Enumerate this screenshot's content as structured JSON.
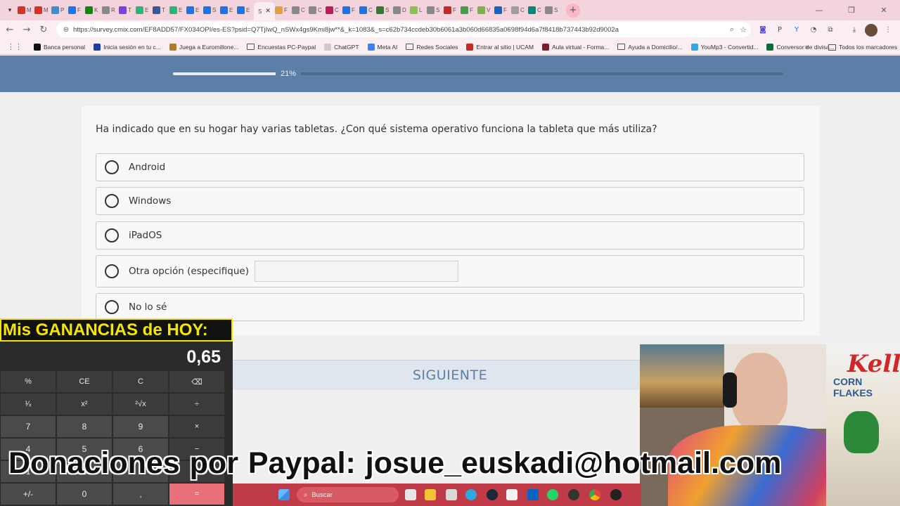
{
  "browser": {
    "tabs": [
      {
        "letter": "M",
        "color": "#d93025"
      },
      {
        "letter": "M",
        "color": "#d93025"
      },
      {
        "letter": "P",
        "color": "#3b8fd4"
      },
      {
        "letter": "F",
        "color": "#1877f2"
      },
      {
        "letter": "K",
        "color": "#0a8a0a"
      },
      {
        "letter": "R",
        "color": "#888888"
      },
      {
        "letter": "T",
        "color": "#7b3fe4"
      },
      {
        "letter": "E",
        "color": "#2bb673"
      },
      {
        "letter": "T",
        "color": "#3b5998"
      },
      {
        "letter": "E",
        "color": "#2bb673"
      },
      {
        "letter": "E",
        "color": "#1a73e8"
      },
      {
        "letter": "S",
        "color": "#1a73e8"
      },
      {
        "letter": "E",
        "color": "#1a73e8"
      },
      {
        "letter": "E",
        "color": "#1a73e8"
      }
    ],
    "active_tab_letter": "S",
    "tabs_after": [
      {
        "letter": "F",
        "color": "#e2a03a"
      },
      {
        "letter": "C",
        "color": "#888888"
      },
      {
        "letter": "C",
        "color": "#888888"
      },
      {
        "letter": "C",
        "color": "#c2185b"
      },
      {
        "letter": "F",
        "color": "#1a73e8"
      },
      {
        "letter": "C",
        "color": "#1a73e8"
      },
      {
        "letter": "S",
        "color": "#2e7d32"
      },
      {
        "letter": "D",
        "color": "#888888"
      },
      {
        "letter": "L",
        "color": "#8bc34a"
      },
      {
        "letter": "S",
        "color": "#888888"
      },
      {
        "letter": "F",
        "color": "#c62828"
      },
      {
        "letter": "F",
        "color": "#43a047"
      },
      {
        "letter": "V",
        "color": "#7cb342"
      },
      {
        "letter": "F",
        "color": "#1565c0"
      },
      {
        "letter": "C",
        "color": "#9e9e9e"
      },
      {
        "letter": "C",
        "color": "#00897b"
      },
      {
        "letter": "S",
        "color": "#888888"
      }
    ],
    "url": "https://survey.cmix.com/EF8ADD57/FX034OPI/es-ES?psid=Q7TjIwQ_nSWx4gs9Kmi8jw**&_k=1083&_s=c62b734ccdeb30b6061a3b060d66835a0698f94d6a7f8418b737443b92d9002a",
    "bookmarks": [
      {
        "label": "Banca personal",
        "color": "#111111",
        "type": "icon"
      },
      {
        "label": "Inicia sesión en tu c...",
        "color": "#1a3fa0",
        "type": "icon"
      },
      {
        "label": "Juega a Euromillone...",
        "color": "#b07a2a",
        "type": "icon"
      },
      {
        "label": "Encuestas PC-Paypal",
        "color": "",
        "type": "folder"
      },
      {
        "label": "ChatGPT",
        "color": "#cccccc",
        "type": "icon"
      },
      {
        "label": "Meta AI",
        "color": "#3b82f6",
        "type": "icon"
      },
      {
        "label": "Redes Sociales",
        "color": "",
        "type": "folder"
      },
      {
        "label": "Entrar al sitio | UCAM",
        "color": "#c62828",
        "type": "icon"
      },
      {
        "label": "Aula virtual - Forma...",
        "color": "#7b1f2e",
        "type": "icon"
      },
      {
        "label": "Ayuda a Domicilio/...",
        "color": "",
        "type": "folder"
      },
      {
        "label": "YouMp3 - Convertid...",
        "color": "#35a7e0",
        "type": "icon"
      },
      {
        "label": "Conversor de divisa...",
        "color": "#0a6a3a",
        "type": "icon"
      }
    ],
    "bookmarks_more": "»",
    "all_bookmarks": "Todos los marcadores"
  },
  "survey": {
    "progress_percent": 21,
    "progress_label": "21%",
    "question": "Ha indicado que en su hogar hay varias tabletas. ¿Con qué sistema operativo funciona la tableta que más utiliza?",
    "options": [
      {
        "label": "Android"
      },
      {
        "label": "Windows"
      },
      {
        "label": "iPadOS"
      },
      {
        "label": "Otra opción (especifique)",
        "has_input": true,
        "input_value": ""
      },
      {
        "label": "No lo sé"
      }
    ],
    "next_label": "SIGUIENTE"
  },
  "calculator": {
    "title": "Mis GANANCIAS de HOY:",
    "display": "0,65",
    "keys": [
      [
        "%",
        "CE",
        "C",
        "⌫"
      ],
      [
        "¹⁄ₓ",
        "x²",
        "²√x",
        "÷"
      ],
      [
        "7",
        "8",
        "9",
        "×"
      ],
      [
        "4",
        "5",
        "6",
        "−"
      ],
      [
        "1",
        "2",
        "3",
        "+"
      ],
      [
        "+/-",
        "0",
        ",",
        "="
      ]
    ]
  },
  "taskbar": {
    "search_label": "Buscar"
  },
  "webcam": {
    "box_brand": "Kellogg's",
    "box_product": "CORN FLAKES"
  },
  "banner": {
    "text": "Donaciones por Paypal:  josue_euskadi@hotmail.com"
  },
  "colors": {
    "header_blue": "#5b7fa6",
    "chrome_pink": "#f3d3dc",
    "calc_title_yellow": "#f5e600",
    "taskbar_red": "#bf3b47",
    "equals_key": "#e9707b"
  }
}
